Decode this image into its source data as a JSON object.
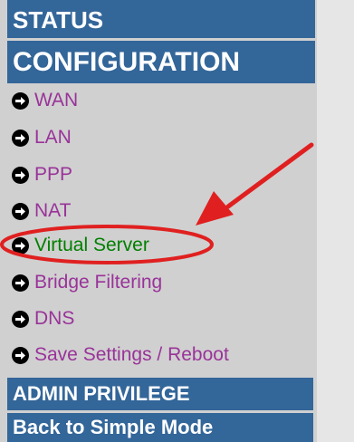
{
  "nav": {
    "status_label": "STATUS",
    "configuration_label": "CONFIGURATION",
    "items": [
      {
        "label": "WAN",
        "icon": "arrow-right-circle-icon",
        "active": false
      },
      {
        "label": "LAN",
        "icon": "arrow-right-circle-icon",
        "active": false
      },
      {
        "label": "PPP",
        "icon": "arrow-right-circle-icon",
        "active": false
      },
      {
        "label": "NAT",
        "icon": "arrow-right-circle-icon",
        "active": false
      },
      {
        "label": "Virtual Server",
        "icon": "arrow-right-circle-icon",
        "active": true
      },
      {
        "label": "Bridge Filtering",
        "icon": "arrow-right-circle-icon",
        "active": false
      },
      {
        "label": "DNS",
        "icon": "arrow-right-circle-icon",
        "active": false
      },
      {
        "label": "Save Settings / Reboot",
        "icon": "arrow-right-circle-icon",
        "active": false
      }
    ],
    "admin_label": "ADMIN PRIVILEGE",
    "back_label": "Back to Simple Mode"
  },
  "colors": {
    "bar_background": "#336699",
    "bar_text": "#ffffff",
    "link": "#993399",
    "active_link": "#008000",
    "annotation": "#e02020",
    "page_background": "#d0d0d0"
  }
}
